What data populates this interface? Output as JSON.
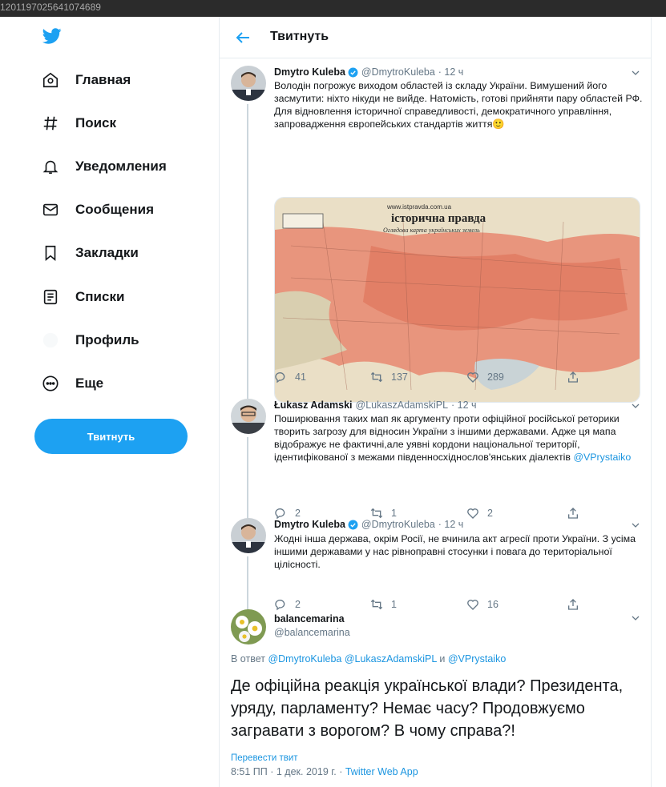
{
  "browser": {
    "url_fragment": "1201197025641074689"
  },
  "sidebar": {
    "items": [
      {
        "label": "Главная",
        "icon": "home-icon"
      },
      {
        "label": "Поиск",
        "icon": "hashtag-icon"
      },
      {
        "label": "Уведомления",
        "icon": "bell-icon"
      },
      {
        "label": "Сообщения",
        "icon": "envelope-icon"
      },
      {
        "label": "Закладки",
        "icon": "bookmark-icon"
      },
      {
        "label": "Списки",
        "icon": "list-icon"
      },
      {
        "label": "Профиль",
        "icon": "profile-icon"
      },
      {
        "label": "Еще",
        "icon": "more-icon"
      }
    ],
    "tweet_button": "Твитнуть"
  },
  "header": {
    "title": "Твитнуть"
  },
  "tweets": [
    {
      "name": "Dmytro Kuleba",
      "handle": "@DmytroKuleba",
      "time": "· 12 ч",
      "text": "Володін погрожує виходом областей із складу України. Вимушений його засмутити: ніхто нікуди не вийде. Натомість, готові прийняти пару областей РФ. Для відновлення історичної справедливості, демократичного управління, запровадження європейських стандартів життя🙂",
      "replies": "41",
      "retweets": "137",
      "likes": "289",
      "image": {
        "site": "www.istpravda.com.ua",
        "title": "історична правда",
        "subtitle": "Оглядова карта українських земель"
      }
    },
    {
      "name": "Łukasz Adamski",
      "handle": "@LukaszAdamskiPL",
      "time": "· 12 ч",
      "text": "Поширювання таких мап як аргументу проти офіційної російської реторики творить загрозу для відносин України з іншими державами. Адже ця мапа відображує не фактичні,але уявні кордони національної території, ідентифікованої з межами південносхіднослов'янських діалектів ",
      "mention": "@VPrystaiko",
      "replies": "2",
      "retweets": "1",
      "likes": "2"
    },
    {
      "name": "Dmytro Kuleba",
      "handle": "@DmytroKuleba",
      "time": "· 12 ч",
      "text": "Жодні інша держава, окрім Росії, не вчинила акт агресії проти України. З усіма іншими державами у нас рівноправні стосунки і повага до територіальної цілісності.",
      "replies": "2",
      "retweets": "1",
      "likes": "16"
    }
  ],
  "focus_tweet": {
    "name": "balancemarina",
    "handle": "@balancemarina",
    "reply_prefix": "В ответ",
    "reply_mentions_1": "@DmytroKuleba @LukaszAdamskiPL",
    "reply_and": "и",
    "reply_mentions_2": "@VPrystaiko",
    "text": "Де офіційна реакція української влади? Президента, уряду, парламенту? Немає часу? Продовжуємо загравати з ворогом? В чому справа?!",
    "translate": "Перевести твит",
    "timestamp": "8:51 ПП · 1 дек. 2019 г. · ",
    "source": "Twitter Web App"
  },
  "colors": {
    "accent": "#1da1f2",
    "muted": "#657786",
    "link": "#1b95e0"
  }
}
